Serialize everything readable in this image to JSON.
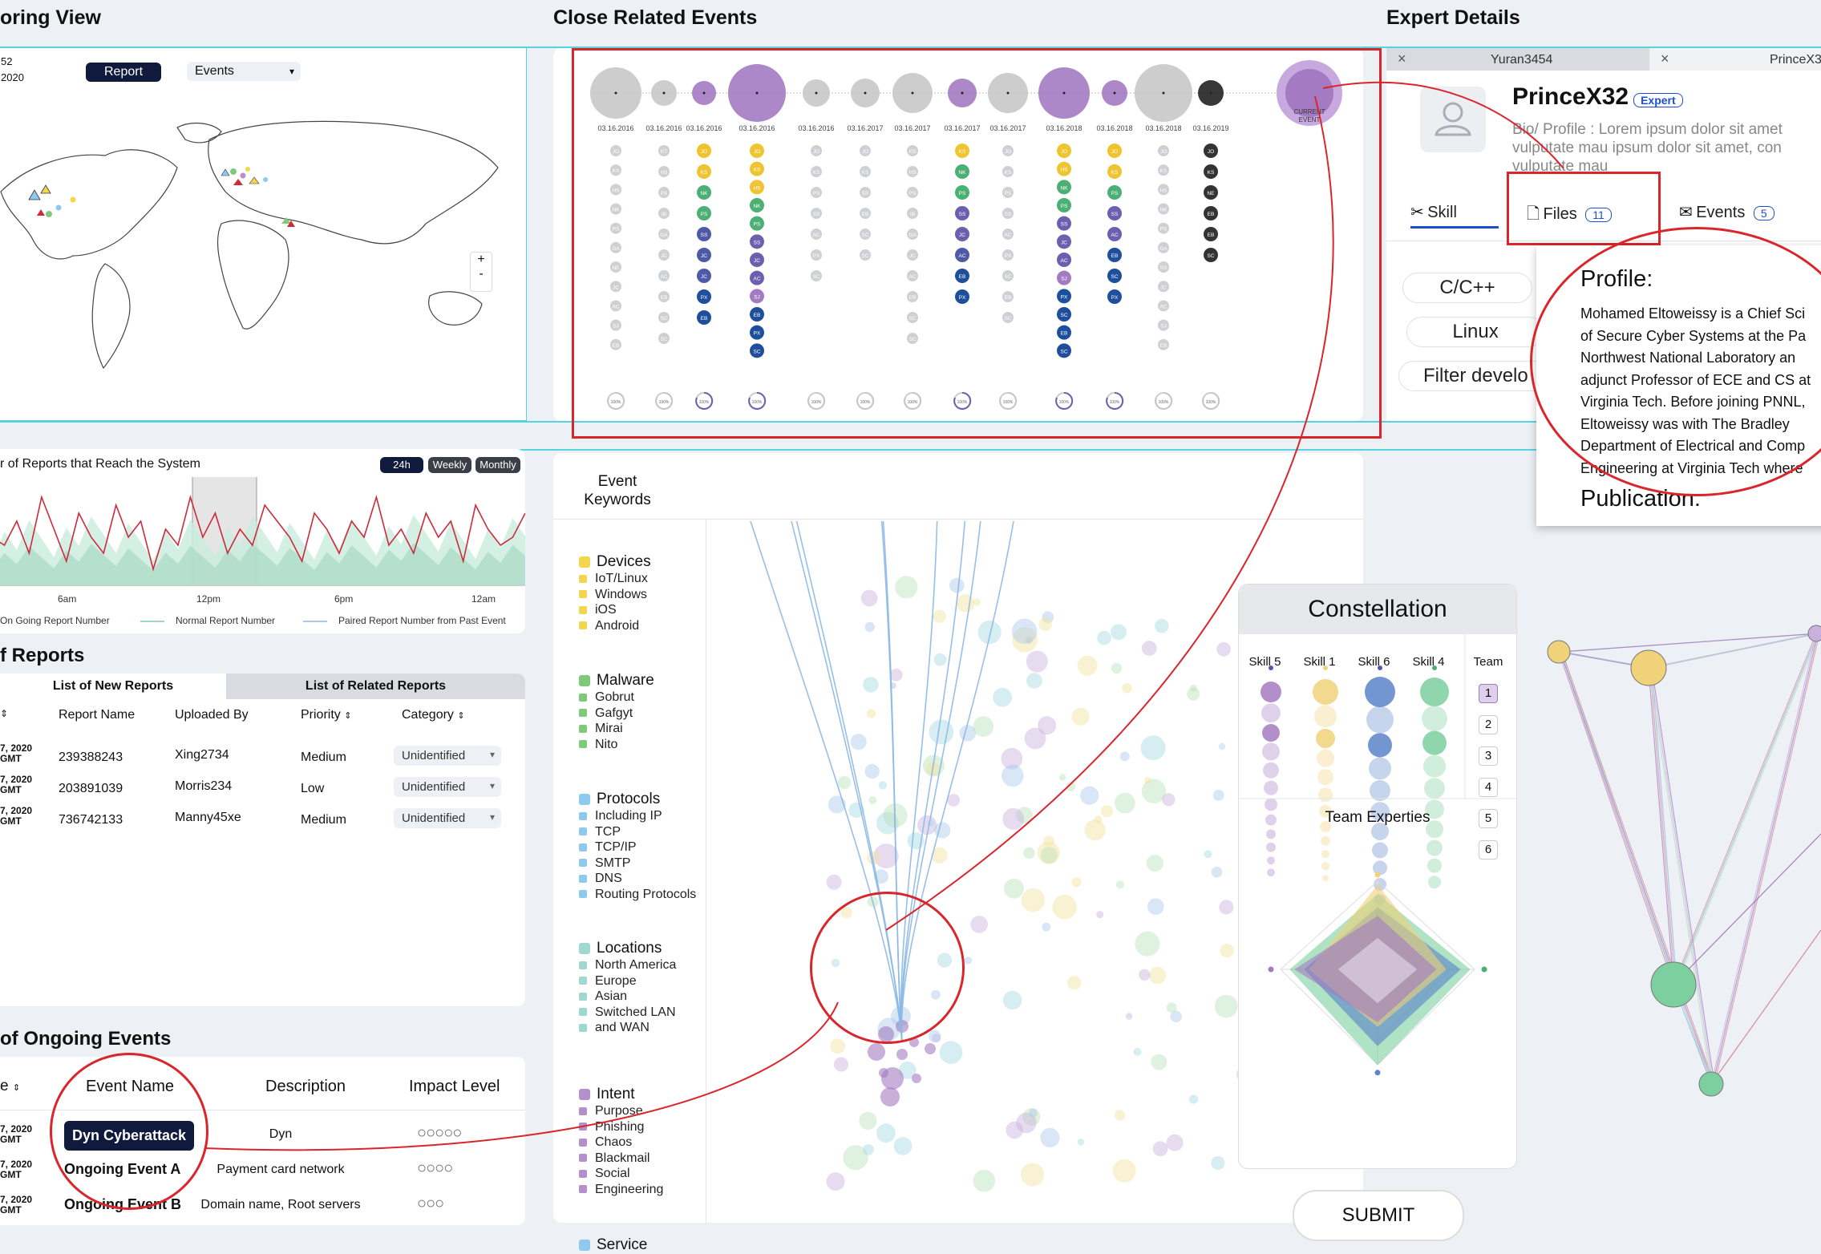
{
  "headers": {
    "monitoring": "oring View",
    "close_related": "Close Related Events",
    "expert_details": "Expert Details"
  },
  "map": {
    "date_top": "52",
    "date_bottom": "2020",
    "tab_report": "Report",
    "dropdown_value": "Events",
    "zoom_in": "+",
    "zoom_out": "-"
  },
  "timeline": {
    "dates": [
      "03.16.2016",
      "03.16.2016",
      "03.16.2016",
      "03.16.2016",
      "03.16.2016",
      "03.16.2017",
      "03.16.2017",
      "03.16.2017",
      "03.16.2017",
      "03.16.2018",
      "03.16.2018",
      "03.16.2018",
      "03.16.2019"
    ],
    "current_label_1": "CURRENT",
    "current_label_2": "EVENT",
    "columns": [
      [
        "JO",
        "KS",
        "HS",
        "NK",
        "PS",
        "GA",
        "NE",
        "JC",
        "AC",
        "SJ",
        "EB"
      ],
      [
        "KT",
        "HS",
        "PS",
        "IB",
        "GA",
        "JC",
        "AC",
        "EB",
        "SC",
        "SC"
      ],
      [
        "JO",
        "KS",
        "NK",
        "PS",
        "SS",
        "JC",
        "JC",
        "PX",
        "EB"
      ],
      [
        "JO",
        "KS",
        "HS",
        "NK",
        "PS",
        "SS",
        "JC",
        "AC",
        "SJ",
        "EB",
        "PX",
        "SC"
      ],
      [
        "JO",
        "KS",
        "PS",
        "SS",
        "AC",
        "PX",
        "SC"
      ],
      [
        "JO",
        "KS",
        "SS",
        "EB",
        "SC",
        "SC"
      ],
      [
        "KS",
        "HS",
        "PS",
        "IB",
        "GA",
        "JC",
        "AC",
        "EB",
        "SC",
        "SC"
      ],
      [
        "KS",
        "NK",
        "PS",
        "SS",
        "JC",
        "AC",
        "EB",
        "PX"
      ],
      [
        "JO",
        "KS",
        "PS",
        "SS",
        "AC",
        "PX",
        "SC",
        "EB",
        "SC"
      ],
      [
        "JO",
        "HS",
        "NK",
        "PS",
        "SS",
        "JC",
        "AC",
        "SJ",
        "PX",
        "SC",
        "EB",
        "SC"
      ],
      [
        "JO",
        "KS",
        "PS",
        "SS",
        "AC",
        "EB",
        "SC",
        "PX"
      ],
      [
        "JO",
        "KS",
        "HS",
        "NK",
        "PS",
        "GA",
        "SS",
        "JC",
        "AC",
        "SJ",
        "EB"
      ],
      [
        "JO",
        "KS",
        "NE",
        "EB",
        "EB",
        "SC"
      ]
    ],
    "progress": [
      "100%",
      "100%",
      "100%",
      "100%",
      "100%",
      "100%",
      "100%",
      "100%",
      "100%",
      "100%",
      "100%",
      "100%",
      "100%"
    ]
  },
  "expert": {
    "tab1": "Yuran3454",
    "tab2": "PrinceX32",
    "close": "×",
    "name": "PrinceX32",
    "role": "Expert",
    "bio_line1": "Bio/ Profile : Lorem ipsum dolor sit amet",
    "bio_line2": "vulputate mau ipsum dolor sit amet, con",
    "bio_line3": "vulputate mau",
    "tab_skill": "Skill",
    "tab_files": "Files",
    "files_count": "11",
    "tab_events": "Events",
    "events_count": "5",
    "skills": [
      "C/C++",
      "Linux",
      "Filter develo"
    ],
    "popup_heading": "Profile:",
    "popup_lines": [
      "Mohamed Eltoweissy is a Chief Sci",
      "of Secure Cyber Systems at the Pa",
      "Northwest National Laboratory an",
      "adjunct Professor of ECE and CS at",
      "Virginia Tech. Before joining PNNL,",
      "Eltoweissy was with The Bradley",
      "Department of Electrical and Comp",
      "Engineering at Virginia Tech where"
    ],
    "popup_publication": "Publication:"
  },
  "reports_chart": {
    "title": "r of Reports that Reach the System",
    "btn_24h": "24h",
    "btn_weekly": "Weekly",
    "btn_monthly": "Monthly",
    "ticks": [
      "6am",
      "12pm",
      "6pm",
      "12am"
    ],
    "legend_1": "On Going Report Number",
    "legend_2": "Normal Report Number",
    "legend_3": "Paired Report Number from Past Event",
    "colors": {
      "ongoing": "#cc2b3b",
      "normal": "#9fd8c0",
      "paired": "#a9c8ea"
    }
  },
  "reports_list": {
    "title": "f Reports",
    "tab_new": "List of New Reports",
    "tab_related": "List of Related Reports",
    "columns": [
      "Report Name",
      "Uploaded By",
      "Priority",
      "Category"
    ],
    "rows": [
      {
        "date1": "7, 2020",
        "date2": "GMT",
        "name": "239388243",
        "user": "Xing2734",
        "priority": "Medium",
        "category": "Unidentified"
      },
      {
        "date1": "7, 2020",
        "date2": "GMT",
        "name": "203891039",
        "user": "Morris234",
        "priority": "Low",
        "category": "Unidentified"
      },
      {
        "date1": "7, 2020",
        "date2": "GMT",
        "name": "736742133",
        "user": "Manny45xe",
        "priority": "Medium",
        "category": "Unidentified"
      }
    ]
  },
  "ongoing": {
    "title": "of Ongoing Events",
    "col_date": "e",
    "col_event": "Event Name",
    "col_desc": "Description",
    "col_impact": "Impact Level",
    "rows": [
      {
        "date1": "7, 2020",
        "date2": "GMT",
        "name": "Dyn Cyberattack",
        "desc": "Dyn",
        "impact": "○○○○○"
      },
      {
        "date1": "7, 2020",
        "date2": "GMT",
        "name": "Ongoing Event A",
        "desc": "Payment card network",
        "impact": "○○○○"
      },
      {
        "date1": "7, 2020",
        "date2": "GMT",
        "name": "Ongoing Event B",
        "desc": "Domain name, Root servers",
        "impact": "○○○"
      }
    ]
  },
  "keywords": {
    "title_1": "Event",
    "title_2": "Keywords",
    "groups": [
      {
        "name": "Devices",
        "color": "#f2d64e",
        "items": [
          "IoT/Linux",
          "Windows",
          "iOS",
          "Android"
        ]
      },
      {
        "name": "Malware",
        "color": "#7fc97a",
        "items": [
          "Gobrut",
          "Gafgyt",
          "Mirai",
          "Nito"
        ]
      },
      {
        "name": "Protocols",
        "color": "#8ec9ee",
        "items": [
          "Including IP",
          "TCP",
          "TCP/IP",
          "SMTP",
          "DNS",
          "Routing Protocols"
        ]
      },
      {
        "name": "Locations",
        "color": "#9ed8d0",
        "items": [
          "North America",
          "Europe",
          "Asian",
          "Switched LAN",
          "and WAN"
        ]
      },
      {
        "name": "Intent",
        "color": "#b58fc9",
        "items": [
          "Purpose",
          "Phishing",
          "Chaos",
          "Blackmail",
          "Social",
          "Engineering"
        ]
      },
      {
        "name": "Service",
        "color": "#8ec9ee",
        "items": []
      }
    ]
  },
  "constellation": {
    "title": "Constellation",
    "skills": [
      "Skill 5",
      "Skill 1",
      "Skill 6",
      "Skill 4"
    ],
    "team_label": "Team",
    "teams": [
      "1",
      "2",
      "3",
      "4",
      "5",
      "6"
    ],
    "team_expertise": "Team Experties",
    "submit": "SUBMIT",
    "colors": {
      "skill5": "#a47bc2",
      "skill1": "#f0d27a",
      "skill6": "#5b84c9",
      "skill4": "#7ccf9f"
    }
  }
}
